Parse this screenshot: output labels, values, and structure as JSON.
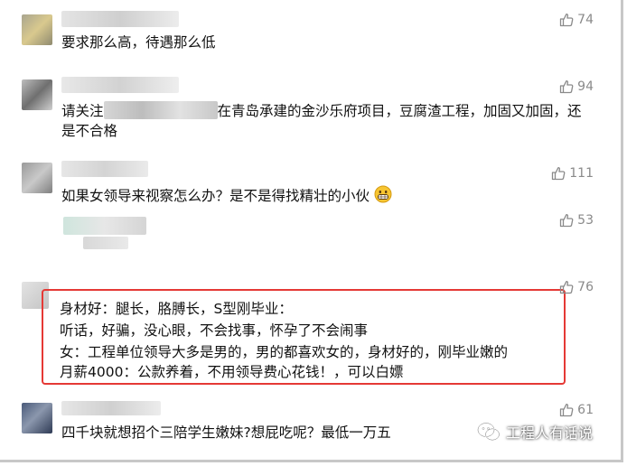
{
  "comments": [
    {
      "text": "要求那么高，待遇那么低",
      "likes": "74"
    },
    {
      "text_line1_prefix": "请关注",
      "text_line1_suffix": "在青岛承建的金沙乐府项目，豆腐渣工程，加固又加固，还",
      "text_line2": "是不合格",
      "likes": "94"
    },
    {
      "text": "如果女领导来视察怎么办？是不是得找精壮的小伙",
      "likes": "111"
    },
    {
      "likes": "53"
    },
    {
      "lines": [
        "身材好：腿长，胳膊长，S型刚毕业：",
        "听话，好骗，没心眼，不会找事，怀孕了不会闹事",
        "女：工程单位领导大多是男的，男的都喜欢女的，身材好的，刚毕业嫩的",
        "月薪4000：公款养着，不用领导费心花钱！，可以白嫖"
      ],
      "likes": "76"
    },
    {
      "text": "四千块就想招个三陪学生嫩妹?想屁吃呢？最低一万五",
      "likes": "61"
    }
  ],
  "watermark": {
    "text": "工程人有话说",
    "icon": "wechat-icon"
  },
  "colors": {
    "highlight_border": "#e53935",
    "like_gray": "#8a8a8a"
  }
}
